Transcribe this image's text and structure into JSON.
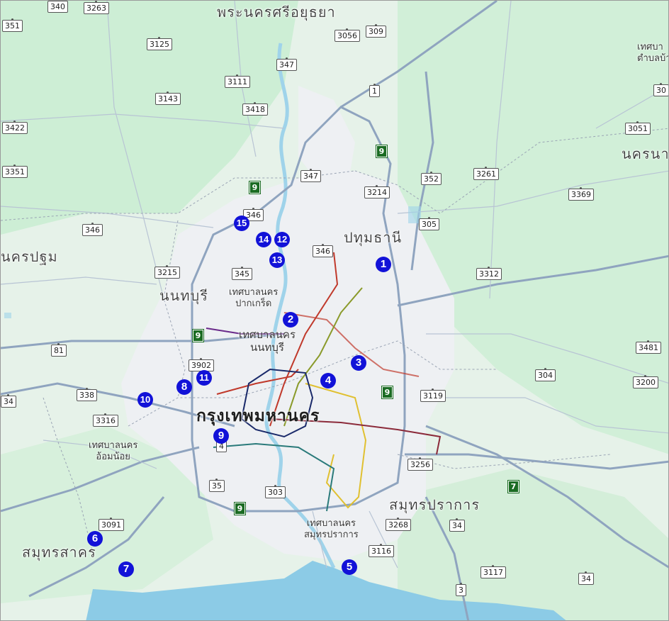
{
  "places": {
    "ayutthaya": "พระนครศรีอยุธยา",
    "pathum_thani": "ปทุมธานี",
    "nonthaburi": "นนทบุรี",
    "nakhon_pathom": "นครปฐม",
    "bangkok": "กรุงเทพมหานคร",
    "samut_prakan": "สมุทรปราการ",
    "samut_sakhon": "สมุทรสาคร",
    "nakhon_nayok_partial": "นครนา",
    "pak_kret": "เทศบาลนคร\nปากเกร็ด",
    "nonthaburi_city": "เทศบาลนคร\nนนทบุรี",
    "om_noi": "เทศบาลนคร\nอ้อมน้อย",
    "samut_prakan_city": "เทศบาลนคร\nสมุทรปราการ",
    "tambon_partial": "เทศบา\nตำบลบ้า"
  },
  "road_shields": [
    "340",
    "3263",
    "351",
    "3125",
    "3056",
    "309",
    "347",
    "3111",
    "3143",
    "1",
    "3418",
    "3422",
    "3351",
    "347",
    "3214",
    "352",
    "3261",
    "3369",
    "3051",
    "305",
    "346",
    "346",
    "346",
    "345",
    "3215",
    "3312",
    "81",
    "3902",
    "338",
    "3481",
    "304",
    "3316",
    "3119",
    "3200",
    "34",
    "4",
    "3256",
    "35",
    "303",
    "3091",
    "3268",
    "34",
    "3116",
    "3117",
    "34",
    "3",
    "30"
  ],
  "green_shields": [
    "9",
    "9",
    "9",
    "9",
    "9",
    "7"
  ],
  "markers": [
    "1",
    "2",
    "3",
    "4",
    "5",
    "6",
    "7",
    "8",
    "9",
    "10",
    "11",
    "12",
    "13",
    "14",
    "15"
  ],
  "colors": {
    "land": "#e9f4ec",
    "green_area": "#c9ecd2",
    "urban": "#eef0f3",
    "water": "#8ccbe6",
    "marker": "#1212d8",
    "highway": "#8fa4bf",
    "line_red": "#c0392b",
    "line_purple": "#6a2a8a",
    "line_olive": "#8a9a2a",
    "line_yellow": "#e0c030",
    "line_maroon": "#8b2a3a",
    "line_navy": "#1a2a6a"
  }
}
